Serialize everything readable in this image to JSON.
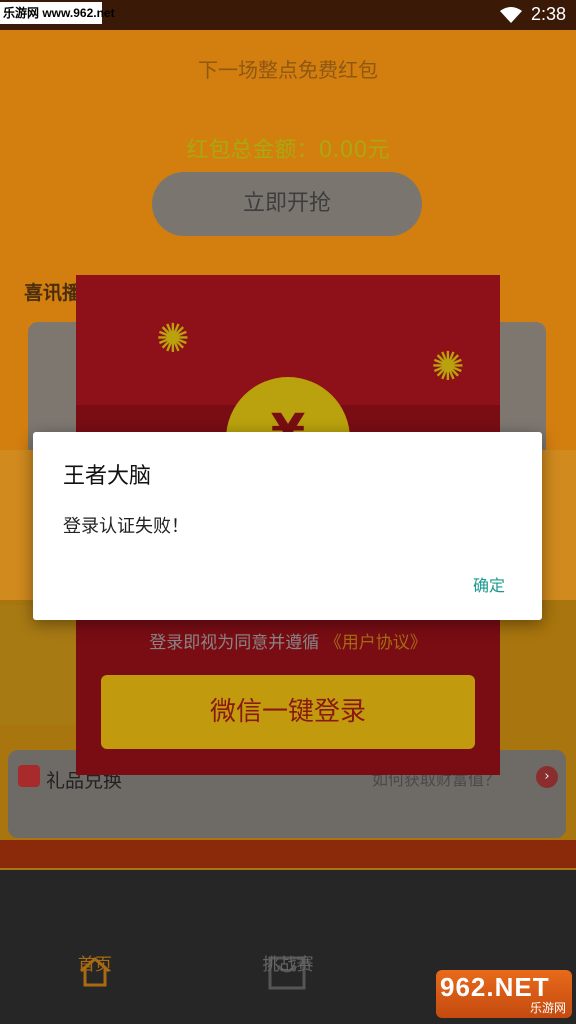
{
  "status_bar": {
    "watermark": "乐游网 www.962.net",
    "time": "2:38"
  },
  "main": {
    "next_packet_label": "下一场整点免费红包",
    "total_amount_label": "红包总金额：0.00元",
    "grab_button": "立即开抢",
    "news_title": "喜讯播"
  },
  "envelope": {
    "coin_symbol": "¥",
    "agree_text": "登录即视为同意并遵循",
    "agreement_link": "《用户协议》",
    "wechat_login_button": "微信一键登录"
  },
  "gift": {
    "label": "礼品兑换",
    "hint": "如何获取财富值？"
  },
  "dialog": {
    "title": "王者大脑",
    "message": "登录认证失败！",
    "ok_button": "确定"
  },
  "bottom_nav": {
    "items": [
      {
        "label": "首页"
      },
      {
        "label": "挑战赛"
      }
    ]
  },
  "watermark_bottom": {
    "big": "962.NET",
    "small": "乐游网"
  },
  "colors": {
    "accent_teal": "#1a9a8e",
    "overlay_orange": "#d98a16",
    "envelope_red": "#7a0d14"
  }
}
